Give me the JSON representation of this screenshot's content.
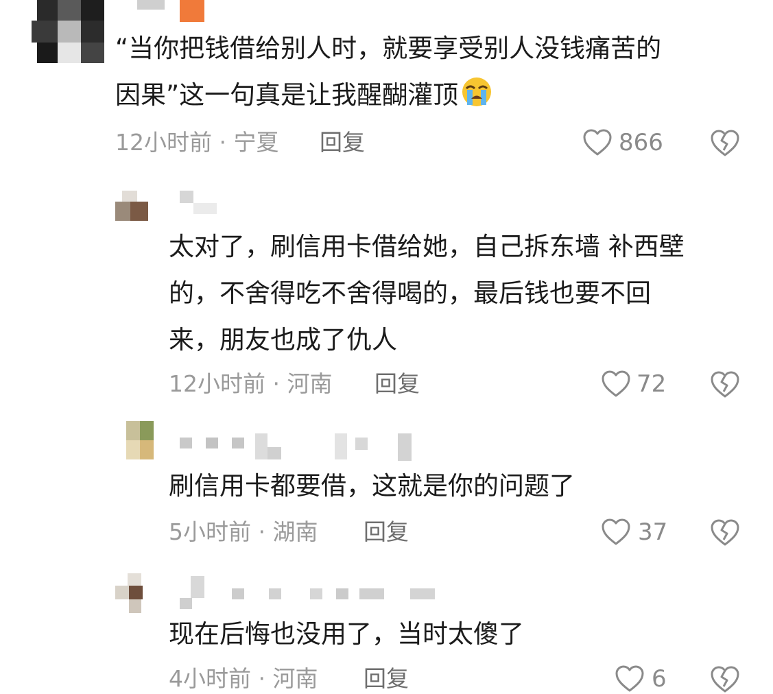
{
  "comments": [
    {
      "lines": [
        "“当你把钱借给别人时，就要享受别人没钱痛苦的",
        "因果”这一句真是让我醒醐灌顶"
      ],
      "emoji": "loudly-crying-face-emoji",
      "time": "12小时前 · 宁夏",
      "reply": "回复",
      "likes": "866"
    },
    {
      "lines": [
        "太对了，刷信用卡借给她，自己拆东墙 补西壁",
        "的，不舍得吃不舍得喝的，最后钱也要不回",
        "来，朋友也成了仇人"
      ],
      "time": "12小时前 · 河南",
      "reply": "回复",
      "likes": "72"
    },
    {
      "lines": [
        "刷信用卡都要借，这就是你的问题了"
      ],
      "time": "5小时前 · 湖南",
      "reply": "回复",
      "likes": "37"
    },
    {
      "lines": [
        "现在后悔也没用了，当时太傻了"
      ],
      "time": "4小时前 · 河南",
      "reply": "回复",
      "likes": "6"
    }
  ],
  "icons": {
    "like": "heart-outline-icon",
    "dislike": "broken-heart-icon"
  },
  "colors": {
    "text": "#1b1b1b",
    "meta": "#9a9a9a",
    "reply": "#6e6e6e"
  }
}
